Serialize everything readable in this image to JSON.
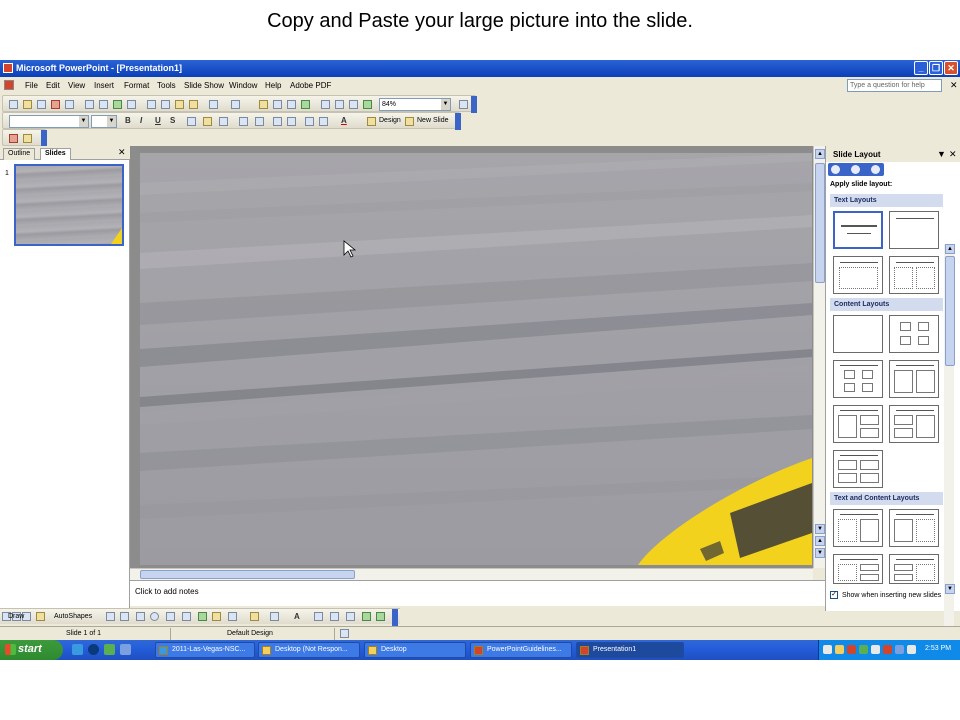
{
  "caption": "Copy and Paste your large picture into the slide.",
  "window": {
    "title": "Microsoft PowerPoint - [Presentation1]",
    "min": "_",
    "restore": "❐",
    "close": "✕"
  },
  "menu": {
    "items": [
      "File",
      "Edit",
      "View",
      "Insert",
      "Format",
      "Tools",
      "Slide Show",
      "Window",
      "Help",
      "Adobe PDF"
    ],
    "help_placeholder": "Type a question for help",
    "help_close": "✕"
  },
  "toolbar": {
    "zoom": "84%",
    "bold": "B",
    "italic": "I",
    "underline": "U",
    "shadow": "S",
    "font_color": "A",
    "design": "Design",
    "new_slide": "New Slide"
  },
  "left_pane": {
    "tabs": [
      "Outline",
      "Slides"
    ],
    "close": "✕",
    "slide_number": "1"
  },
  "notes": {
    "placeholder": "Click to add notes"
  },
  "task_pane": {
    "title": "Slide Layout",
    "dropdown": "▼",
    "close": "✕",
    "apply": "Apply slide layout:",
    "sections": [
      "Text Layouts",
      "Content Layouts",
      "Text and Content Layouts"
    ],
    "show_checkbox": "Show when inserting new slides",
    "show_checked": "✓"
  },
  "draw_toolbar": {
    "draw": "Draw",
    "autoshapes": "AutoShapes"
  },
  "status": {
    "slide": "Slide 1 of 1",
    "design": "Default Design"
  },
  "taskbar": {
    "start": "start",
    "items": [
      "2011-Las-Vegas-NSC...",
      "Desktop (Not Respon...",
      "Desktop",
      "PowerPointGuidelines...",
      "Presentation1"
    ],
    "clock": "2:53 PM"
  },
  "colors": {
    "xp_blue": "#245edb",
    "start_green": "#3c9a3c",
    "car_yellow": "#f2d21c",
    "asphalt": "#a9a8ad"
  }
}
